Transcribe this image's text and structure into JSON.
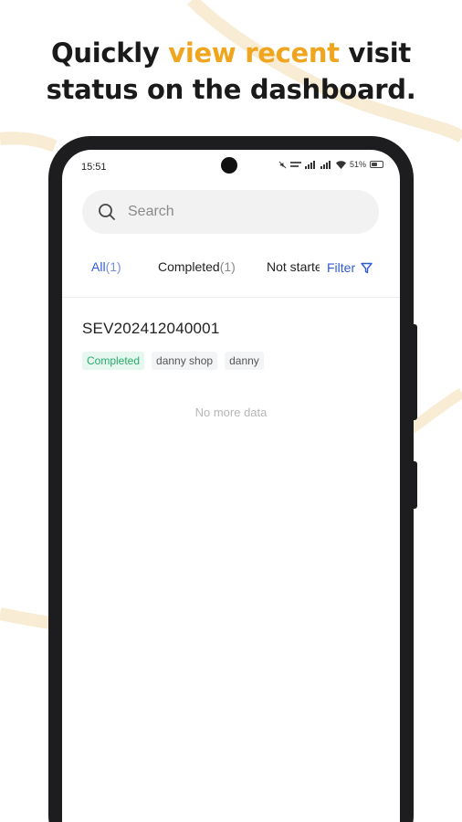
{
  "headline": {
    "part1": "Quickly ",
    "accent": "view recent",
    "part2": " visit",
    "line2": "status on the dashboard."
  },
  "colors": {
    "accent": "#f0a51e",
    "primary": "#2f5bd8",
    "success": "#2aaa6a",
    "decoration": "#f8ecd4"
  },
  "status_bar": {
    "time": "15:51",
    "battery": "51%",
    "battery_level": 0.51,
    "icons": [
      "mute-icon",
      "data-speed-icon",
      "signal-icon",
      "signal-icon",
      "wifi-icon",
      "battery-icon"
    ]
  },
  "search": {
    "icon": "search-icon",
    "placeholder": "Search"
  },
  "tabs": [
    {
      "label": "All",
      "count": "(1)"
    },
    {
      "label": "Completed",
      "count": "(1)"
    },
    {
      "label": "Not started",
      "count": ""
    }
  ],
  "filter": {
    "label": "Filter",
    "icon": "filter-icon"
  },
  "records": [
    {
      "id": "SEV202412040001",
      "status": "Completed",
      "shop": "danny shop",
      "person": "danny"
    }
  ],
  "footer_text": "No more data"
}
